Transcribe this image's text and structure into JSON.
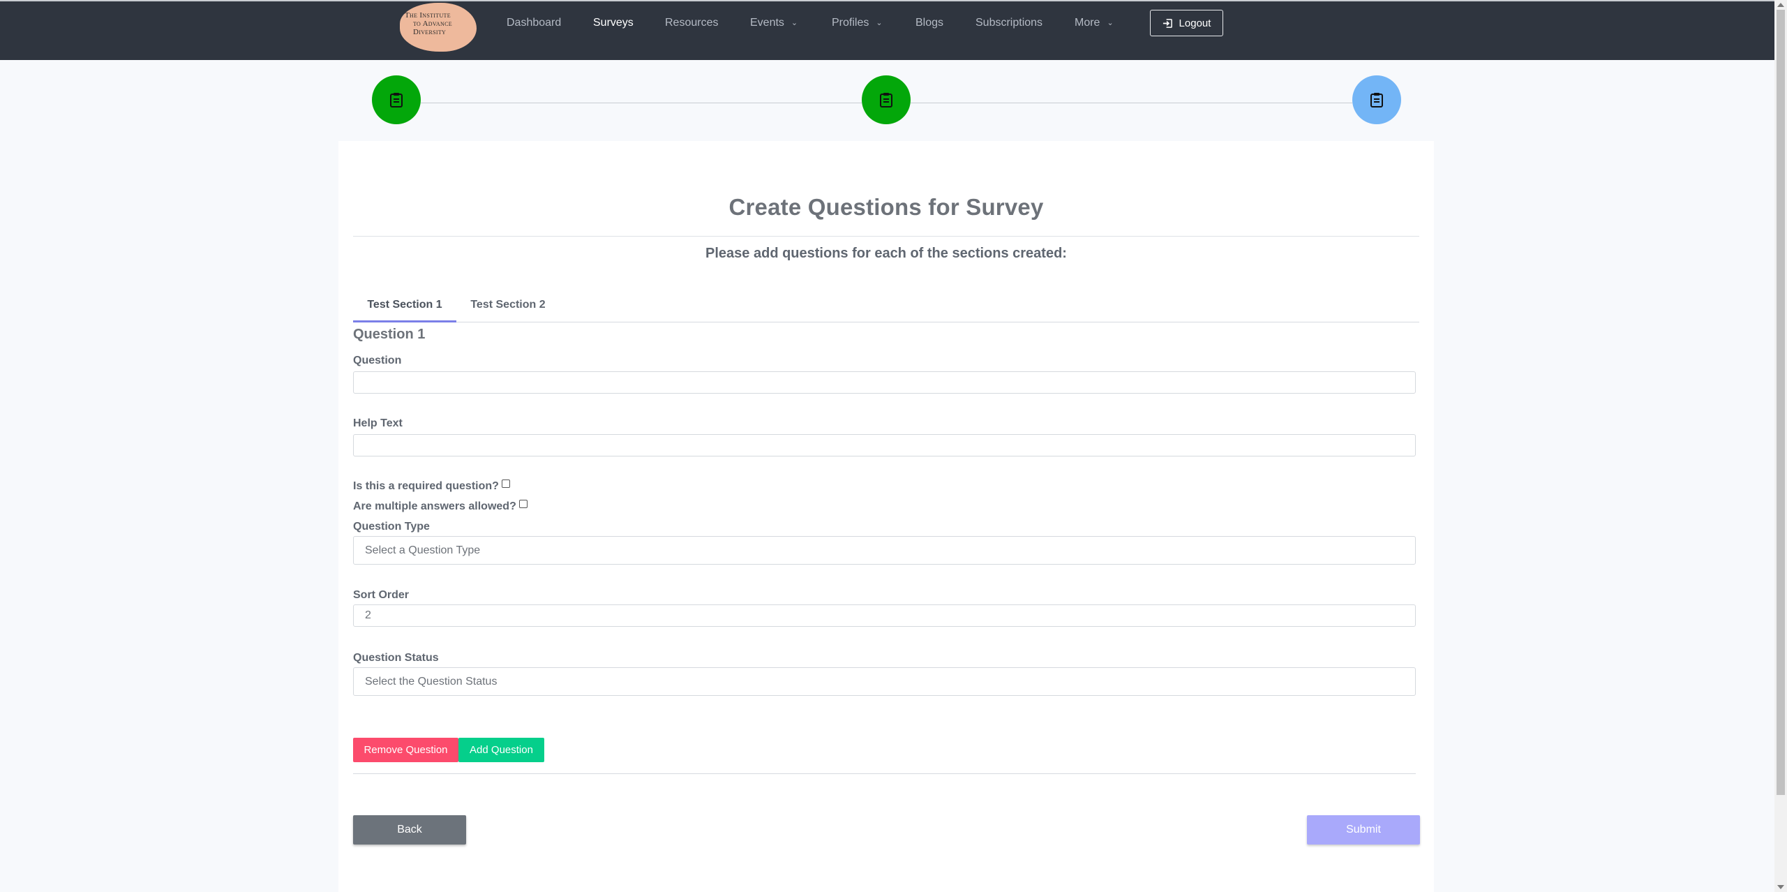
{
  "logo": {
    "line1": "The Institute",
    "line2": "to Advance Diversity"
  },
  "nav": {
    "items": [
      {
        "label": "Dashboard",
        "active": false
      },
      {
        "label": "Surveys",
        "active": true
      },
      {
        "label": "Resources",
        "active": false
      },
      {
        "label": "Events",
        "active": false,
        "dropdown": true
      },
      {
        "label": "Profiles",
        "active": false,
        "dropdown": true
      },
      {
        "label": "Blogs",
        "active": false
      },
      {
        "label": "Subscriptions",
        "active": false
      },
      {
        "label": "More",
        "active": false,
        "dropdown": true
      }
    ],
    "logout_label": "Logout",
    "chevron": "⌄"
  },
  "stepper": {
    "steps": [
      {
        "state": "done",
        "icon": "clipboard-icon",
        "color": "#03a70a"
      },
      {
        "state": "done",
        "icon": "clipboard-icon",
        "color": "#03a70a"
      },
      {
        "state": "current",
        "icon": "clipboard-icon",
        "color": "#73b5f6"
      }
    ]
  },
  "main": {
    "title": "Create Questions for Survey",
    "subtitle": "Please add questions for each of the sections created:",
    "tabs": [
      {
        "label": "Test Section 1",
        "active": true
      },
      {
        "label": "Test Section 2",
        "active": false
      }
    ],
    "question_heading": "Question 1",
    "fields": {
      "question_label": "Question",
      "question_value": "",
      "help_text_label": "Help Text",
      "help_text_value": "",
      "required_label": "Is this a required question?",
      "required_checked": false,
      "multiple_label": "Are multiple answers allowed?",
      "multiple_checked": false,
      "question_type_label": "Question Type",
      "question_type_placeholder": "Select a Question Type",
      "sort_order_label": "Sort Order",
      "sort_order_value": "2",
      "question_status_label": "Question Status",
      "question_status_placeholder": "Select the Question Status"
    },
    "remove_question_label": "Remove Question",
    "add_question_label": "Add Question",
    "back_label": "Back",
    "submit_label": "Submit"
  },
  "colors": {
    "navbar": "#2f353f",
    "done_step": "#03a70a",
    "current_step": "#73b5f6",
    "remove": "#fc4b6c",
    "add": "#05cf8b",
    "back": "#6c737b",
    "submit": "#a9a9fb",
    "tab_underline": "#7b7fe8"
  }
}
